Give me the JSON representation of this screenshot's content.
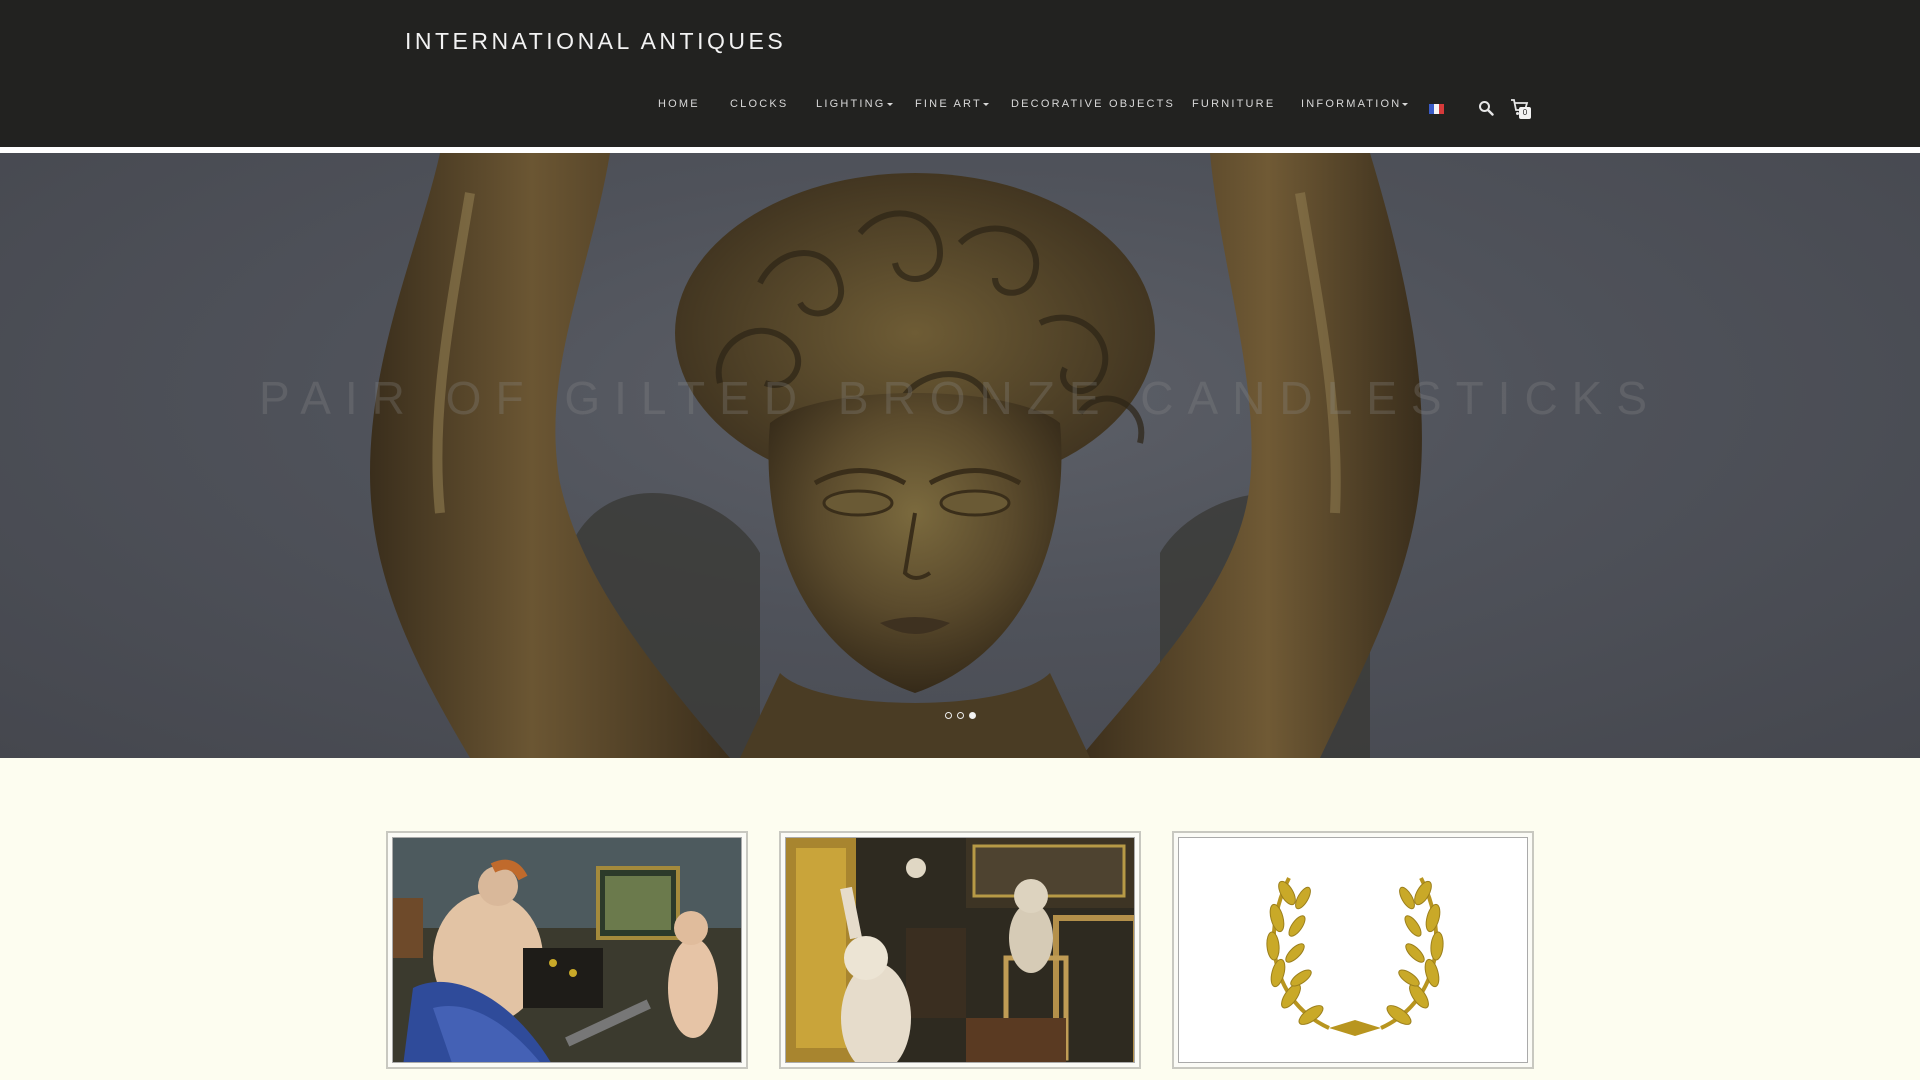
{
  "site": {
    "title": "INTERNATIONAL ANTIQUES"
  },
  "nav": {
    "items": [
      {
        "label": "HOME",
        "dropdown": false
      },
      {
        "label": "CLOCKS",
        "dropdown": false
      },
      {
        "label": "LIGHTING",
        "dropdown": true
      },
      {
        "label": "FINE ART",
        "dropdown": true
      },
      {
        "label": "DECORATIVE OBJECTS",
        "dropdown": false
      },
      {
        "label": "FURNITURE",
        "dropdown": false
      },
      {
        "label": "INFORMATION",
        "dropdown": true
      }
    ],
    "language_icon": "flag-fr-icon",
    "search_icon": "search-icon",
    "cart_icon": "cart-icon",
    "cart_count": "0"
  },
  "hero": {
    "caption": "PAIR OF GILTED BRONZE CANDLESTICKS",
    "slide_count": 3,
    "active_slide": 3
  },
  "cards": [
    {
      "subject": "painting"
    },
    {
      "subject": "gallery"
    },
    {
      "subject": "laurel-wreath"
    }
  ],
  "colors": {
    "header_bg": "#222220",
    "page_bg": "#fdfdf0",
    "bronze": "#5a4a2c",
    "gold": "#c9a928"
  }
}
